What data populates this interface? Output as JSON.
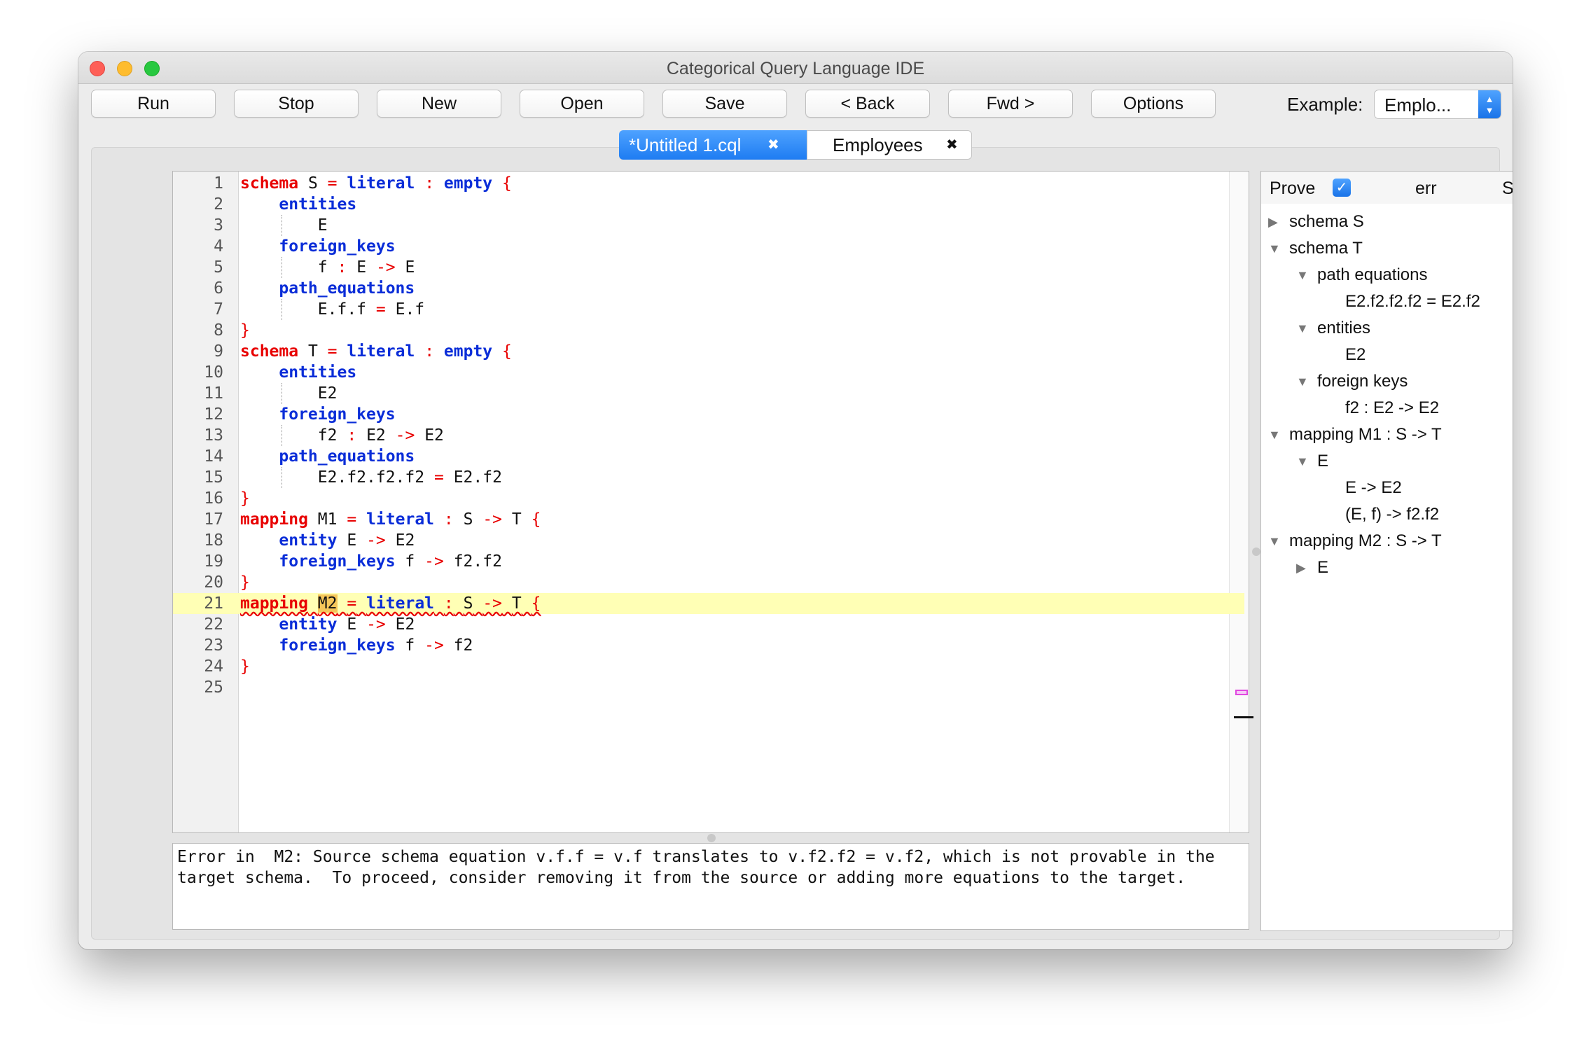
{
  "window": {
    "title": "Categorical Query Language IDE"
  },
  "toolbar": {
    "buttons": [
      "Run",
      "Stop",
      "New",
      "Open",
      "Save",
      "< Back",
      "Fwd >",
      "Options"
    ],
    "example_label": "Example:",
    "example_value": "Emplo..."
  },
  "tabs": [
    {
      "label": "*Untitled 1.cql",
      "close": "✖",
      "active": true
    },
    {
      "label": "Employees",
      "close": "✖",
      "active": false
    }
  ],
  "editor": {
    "line_numbers": [
      "1",
      "2",
      "3",
      "4",
      "5",
      "6",
      "7",
      "8",
      "9",
      "10",
      "11",
      "12",
      "13",
      "14",
      "15",
      "16",
      "17",
      "18",
      "19",
      "20",
      "21",
      "22",
      "23",
      "24",
      "25"
    ],
    "tokens": {
      "schema": "schema",
      "literal": "literal",
      "empty": "empty",
      "entities": "entities",
      "foreign_keys": "foreign_keys",
      "path_equations": "path_equations",
      "mapping": "mapping",
      "entity": "entity",
      "eq": "=",
      "colon": ":",
      "arrow": "->",
      "lbrace": "{",
      "rbrace": "}",
      "S": "S",
      "T": "T",
      "E": "E",
      "f": "f",
      "E2": "E2",
      "f2": "f2",
      "M1": "M1",
      "M2": "M2",
      "eq_s": "E.f.f",
      "eq_s_rhs": "E.f",
      "eq_t": "E2.f2.f2.f2",
      "eq_t_rhs": "E2.f2",
      "f2f2": "f2.f2"
    },
    "highlighted_line": 21
  },
  "error": {
    "line1": "Error in  M2: Source schema equation v.f.f = v.f translates to v.f2.f2 = v.f2, which is not provable in the",
    "line2": "target schema.  To proceed, consider removing it from the source or adding more equations to the target."
  },
  "tree": {
    "prove_label": "Prove",
    "prove_checked": true,
    "err_label": "err",
    "sort_label": "Sort",
    "sort_checked": false,
    "nodes": {
      "schema_s": "schema S",
      "schema_t": "schema T",
      "path_equations": "path equations",
      "path_eq_value": "E2.f2.f2.f2 = E2.f2",
      "entities": "entities",
      "entities_value": "E2",
      "foreign_keys": "foreign keys",
      "fk_value": "f2 : E2 -> E2",
      "mapping_m1": "mapping M1 : S -> T",
      "m1_e": "E",
      "m1_e_value": "E -> E2",
      "m1_fk_value": "(E, f) -> f2.f2",
      "mapping_m2": "mapping M2 : S -> T",
      "m2_e": "E"
    }
  },
  "colors": {
    "accent": "#1a73e8",
    "keyword_red": "#e80000",
    "keyword_blue": "#0a2dd8",
    "highlight": "#ffffb5"
  }
}
